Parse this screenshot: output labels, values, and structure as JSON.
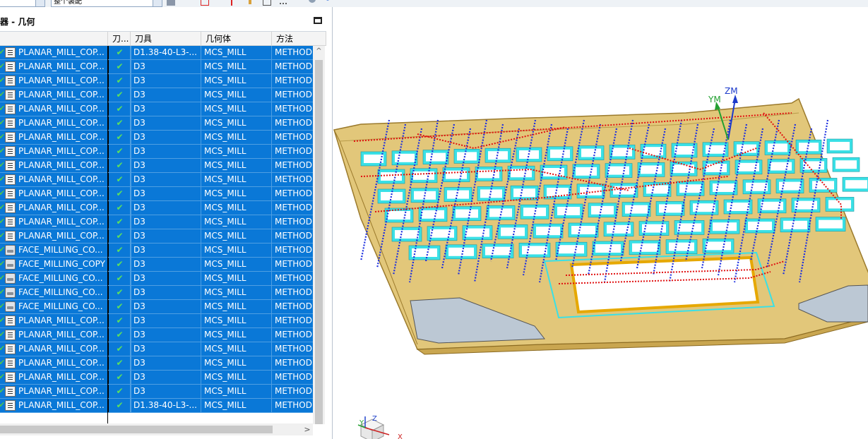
{
  "toolbar": {
    "combo1_value": "",
    "combo2_value": "整个装配"
  },
  "navigator": {
    "title": "器 - 几何"
  },
  "table": {
    "headers": [
      "",
      "刀...",
      "刀具",
      "几何体",
      "方法"
    ],
    "rows": [
      {
        "icon": "planar",
        "name": "PLANAR_MILL_COP...",
        "tool": "D1.38-40-L3-...",
        "geom": "MCS_MILL",
        "method": "METHOD"
      },
      {
        "icon": "planar",
        "name": "PLANAR_MILL_COP...",
        "tool": "D3",
        "geom": "MCS_MILL",
        "method": "METHOD"
      },
      {
        "icon": "planar",
        "name": "PLANAR_MILL_COP...",
        "tool": "D3",
        "geom": "MCS_MILL",
        "method": "METHOD"
      },
      {
        "icon": "planar",
        "name": "PLANAR_MILL_COP...",
        "tool": "D3",
        "geom": "MCS_MILL",
        "method": "METHOD"
      },
      {
        "icon": "planar",
        "name": "PLANAR_MILL_COP...",
        "tool": "D3",
        "geom": "MCS_MILL",
        "method": "METHOD"
      },
      {
        "icon": "planar",
        "name": "PLANAR_MILL_COP...",
        "tool": "D3",
        "geom": "MCS_MILL",
        "method": "METHOD"
      },
      {
        "icon": "planar",
        "name": "PLANAR_MILL_COP...",
        "tool": "D3",
        "geom": "MCS_MILL",
        "method": "METHOD"
      },
      {
        "icon": "planar",
        "name": "PLANAR_MILL_COP...",
        "tool": "D3",
        "geom": "MCS_MILL",
        "method": "METHOD"
      },
      {
        "icon": "planar",
        "name": "PLANAR_MILL_COP...",
        "tool": "D3",
        "geom": "MCS_MILL",
        "method": "METHOD"
      },
      {
        "icon": "planar",
        "name": "PLANAR_MILL_COP...",
        "tool": "D3",
        "geom": "MCS_MILL",
        "method": "METHOD"
      },
      {
        "icon": "planar",
        "name": "PLANAR_MILL_COP...",
        "tool": "D3",
        "geom": "MCS_MILL",
        "method": "METHOD"
      },
      {
        "icon": "planar",
        "name": "PLANAR_MILL_COP...",
        "tool": "D3",
        "geom": "MCS_MILL",
        "method": "METHOD"
      },
      {
        "icon": "planar",
        "name": "PLANAR_MILL_COP...",
        "tool": "D3",
        "geom": "MCS_MILL",
        "method": "METHOD"
      },
      {
        "icon": "planar",
        "name": "PLANAR_MILL_COP...",
        "tool": "D3",
        "geom": "MCS_MILL",
        "method": "METHOD"
      },
      {
        "icon": "face",
        "name": "FACE_MILLING_CO...",
        "tool": "D3",
        "geom": "MCS_MILL",
        "method": "METHOD"
      },
      {
        "icon": "face",
        "name": "FACE_MILLING_COPY",
        "tool": "D3",
        "geom": "MCS_MILL",
        "method": "METHOD"
      },
      {
        "icon": "face",
        "name": "FACE_MILLING_CO...",
        "tool": "D3",
        "geom": "MCS_MILL",
        "method": "METHOD"
      },
      {
        "icon": "face",
        "name": "FACE_MILLING_CO...",
        "tool": "D3",
        "geom": "MCS_MILL",
        "method": "METHOD"
      },
      {
        "icon": "face",
        "name": "FACE_MILLING_CO...",
        "tool": "D3",
        "geom": "MCS_MILL",
        "method": "METHOD"
      },
      {
        "icon": "planar",
        "name": "PLANAR_MILL_COP...",
        "tool": "D3",
        "geom": "MCS_MILL",
        "method": "METHOD"
      },
      {
        "icon": "planar",
        "name": "PLANAR_MILL_COP...",
        "tool": "D3",
        "geom": "MCS_MILL",
        "method": "METHOD"
      },
      {
        "icon": "planar",
        "name": "PLANAR_MILL_COP...",
        "tool": "D3",
        "geom": "MCS_MILL",
        "method": "METHOD"
      },
      {
        "icon": "planar",
        "name": "PLANAR_MILL_COP...",
        "tool": "D3",
        "geom": "MCS_MILL",
        "method": "METHOD"
      },
      {
        "icon": "planar",
        "name": "PLANAR_MILL_COP...",
        "tool": "D3",
        "geom": "MCS_MILL",
        "method": "METHOD"
      },
      {
        "icon": "planar",
        "name": "PLANAR_MILL_COP...",
        "tool": "D3",
        "geom": "MCS_MILL",
        "method": "METHOD"
      },
      {
        "icon": "planar",
        "name": "PLANAR_MILL_COP...",
        "tool": "D1.38-40-L3-...",
        "geom": "MCS_MILL",
        "method": "METHOD"
      }
    ],
    "status_glyph": "✔"
  },
  "viewport": {
    "csys_labels": {
      "ym": "YM",
      "zm": "ZM"
    },
    "triad_labels": {
      "y": "Y",
      "z": "Z",
      "x": "X"
    }
  },
  "colors": {
    "selection": "#0a78d7",
    "part_body": "#e2c77a",
    "toolpath_cut": "#1c2ee0",
    "toolpath_rapid": "#e01010",
    "pocket_highlight": "#3ae0e6"
  }
}
